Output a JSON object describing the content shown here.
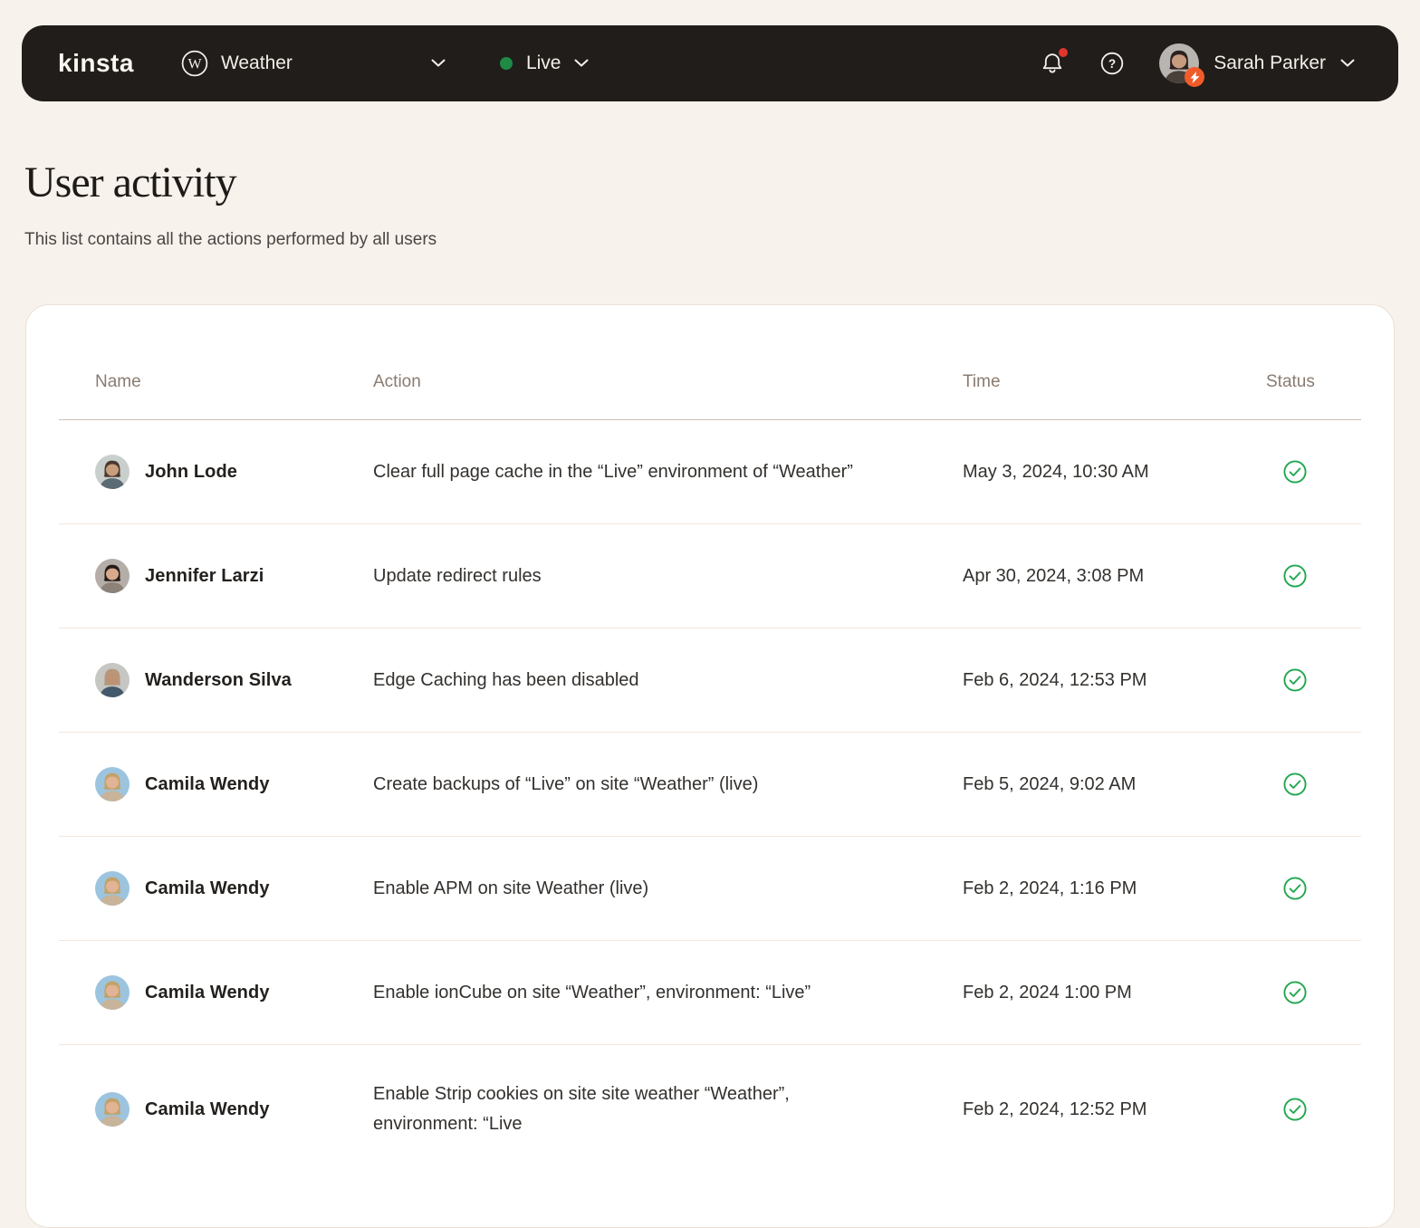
{
  "navbar": {
    "logo_text": "kinsta",
    "site_selector": {
      "label": "Weather",
      "icon": "wordpress-icon"
    },
    "env_selector": {
      "label": "Live"
    },
    "user": {
      "name": "Sarah Parker"
    }
  },
  "page": {
    "title": "User activity",
    "subtitle": "This list contains all the actions performed by all users"
  },
  "table": {
    "columns": [
      "Name",
      "Action",
      "Time",
      "Status"
    ],
    "rows": [
      {
        "name": "John Lode",
        "action": "Clear full page cache in the “Live” environment of “Weather”",
        "time": "May 3, 2024, 10:30 AM",
        "status": "success",
        "avatar": {
          "bg": "#C9CFCC",
          "hair": "#4A392E",
          "skin": "#C99E7E",
          "shirt": "#5A6B74"
        }
      },
      {
        "name": "Jennifer Larzi",
        "action": "Update redirect rules",
        "time": "Apr 30, 2024, 3:08 PM",
        "status": "success",
        "avatar": {
          "bg": "#B5AEA8",
          "hair": "#241C18",
          "skin": "#D8A98C",
          "shirt": "#8D8279"
        }
      },
      {
        "name": "Wanderson Silva",
        "action": "Edge Caching has been disabled",
        "time": "Feb 6, 2024, 12:53 PM",
        "status": "success",
        "avatar": {
          "bg": "#C6C6C3",
          "hair": "#B5977D",
          "skin": "#BE9274",
          "shirt": "#43596B"
        }
      },
      {
        "name": "Camila Wendy",
        "action": "Create backups of “Live” on site “Weather” (live)",
        "time": "Feb 5, 2024, 9:02 AM",
        "status": "success",
        "avatar": {
          "bg": "#9CC4DE",
          "hair": "#C2A267",
          "skin": "#E2B394",
          "shirt": "#C7B49B"
        }
      },
      {
        "name": "Camila Wendy",
        "action": "Enable APM on site Weather (live)",
        "time": "Feb 2, 2024, 1:16 PM",
        "status": "success",
        "avatar": {
          "bg": "#9CC4DE",
          "hair": "#C2A267",
          "skin": "#E2B394",
          "shirt": "#C7B49B"
        }
      },
      {
        "name": "Camila Wendy",
        "action": "Enable ionCube on site “Weather”, environment: “Live”",
        "time": "Feb 2, 2024 1:00 PM",
        "status": "success",
        "avatar": {
          "bg": "#9CC4DE",
          "hair": "#C2A267",
          "skin": "#E2B394",
          "shirt": "#C7B49B"
        }
      },
      {
        "name": "Camila Wendy",
        "action": "Enable Strip cookies on site site weather “Weather”, environment: “Live",
        "time": "Feb 2, 2024, 12:52 PM",
        "status": "success",
        "avatar": {
          "bg": "#9CC4DE",
          "hair": "#C2A267",
          "skin": "#E2B394",
          "shirt": "#C7B49B"
        }
      }
    ]
  },
  "nav_avatar": {
    "bg": "#B8B4B0",
    "hair": "#2B2220",
    "skin": "#C79B7E",
    "shirt": "#4A403A"
  },
  "colors": {
    "navbar_bg": "#211D1A",
    "page_bg": "#F7F2EC",
    "live_dot_green": "#1E8A44",
    "success_green": "#22A74F",
    "notification_red": "#E0352C",
    "badge_orange": "#F15B2A"
  }
}
